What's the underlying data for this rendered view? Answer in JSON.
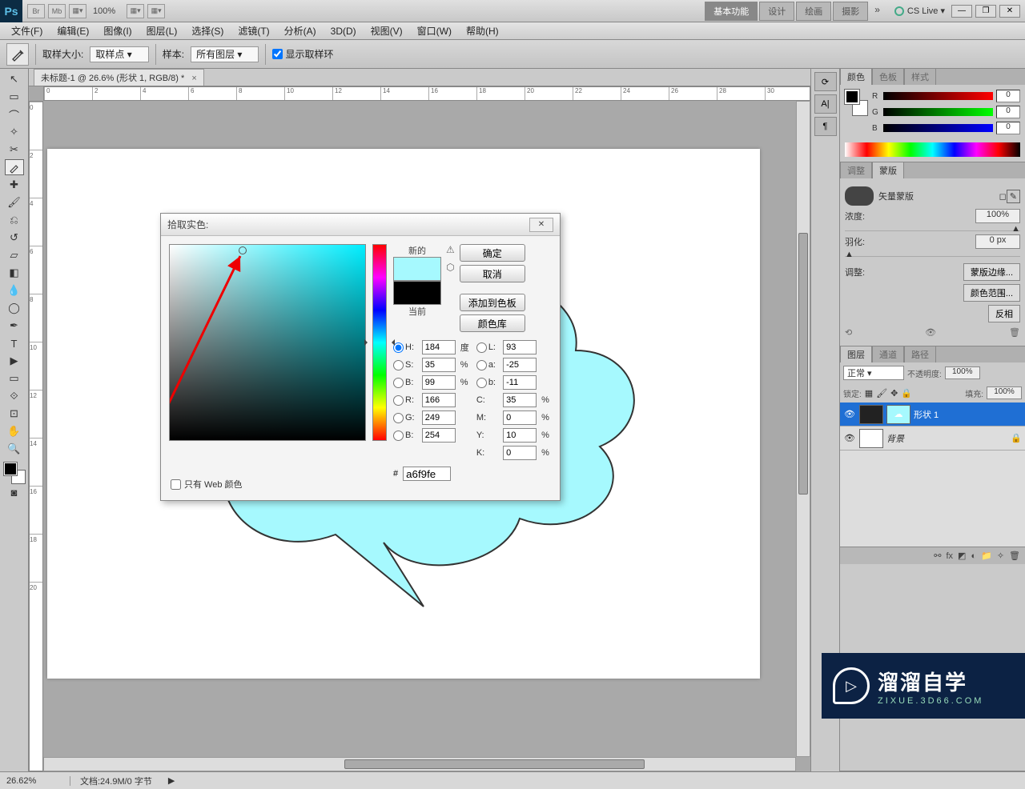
{
  "titlebar": {
    "zoom": "100%",
    "workspaces": [
      "基本功能",
      "设计",
      "绘画",
      "摄影"
    ],
    "cslive": "CS Live"
  },
  "menu": [
    "文件(F)",
    "编辑(E)",
    "图像(I)",
    "图层(L)",
    "选择(S)",
    "滤镜(T)",
    "分析(A)",
    "3D(D)",
    "视图(V)",
    "窗口(W)",
    "帮助(H)"
  ],
  "options": {
    "sample_size_label": "取样大小:",
    "sample_size_value": "取样点",
    "sample_label": "样本:",
    "sample_value": "所有图层",
    "show_ring": "显示取样环"
  },
  "doc_tab": "未标题-1 @ 26.6% (形状 1, RGB/8) *",
  "ruler_marks_h": [
    "0",
    "2",
    "4",
    "6",
    "8",
    "10",
    "12",
    "14",
    "16",
    "18",
    "20",
    "22",
    "24",
    "26",
    "28",
    "30"
  ],
  "ruler_marks_v": [
    "0",
    "2",
    "4",
    "6",
    "8",
    "10",
    "12",
    "14",
    "16",
    "18",
    "20"
  ],
  "color_panel": {
    "tabs": [
      "颜色",
      "色板",
      "样式"
    ],
    "r": "0",
    "g": "0",
    "b": "0"
  },
  "adjust_panel": {
    "tabs": [
      "调整",
      "蒙版"
    ],
    "mask_type": "矢量蒙版",
    "density_label": "浓度:",
    "density_value": "100%",
    "feather_label": "羽化:",
    "feather_value": "0 px",
    "adjust_label": "调整:",
    "btn_mask_edge": "蒙版边缘...",
    "btn_color_range": "颜色范围...",
    "btn_invert": "反相"
  },
  "layers_panel": {
    "tabs": [
      "图层",
      "通道",
      "路径"
    ],
    "blend_mode": "正常",
    "opacity_label": "不透明度:",
    "opacity_value": "100%",
    "lock_label": "锁定:",
    "fill_label": "填充:",
    "fill_value": "100%",
    "layers": [
      {
        "name": "形状 1",
        "selected": true,
        "has_mask": true
      },
      {
        "name": "背景",
        "selected": false,
        "locked": true
      }
    ]
  },
  "dialog": {
    "title": "拾取实色:",
    "new_label": "新的",
    "cur_label": "当前",
    "btn_ok": "确定",
    "btn_cancel": "取消",
    "btn_add": "添加到色板",
    "btn_lib": "颜色库",
    "H": "184",
    "H_unit": "度",
    "S": "35",
    "S_unit": "%",
    "Bv": "99",
    "B_unit": "%",
    "L": "93",
    "a": "-25",
    "b_lab": "-11",
    "R": "166",
    "G": "249",
    "B": "254",
    "C": "35",
    "C_unit": "%",
    "M": "0",
    "M_unit": "%",
    "Y": "10",
    "Y_unit": "%",
    "K": "0",
    "K_unit": "%",
    "hex": "a6f9fe",
    "web_only": "只有 Web 颜色"
  },
  "statusbar": {
    "zoom": "26.62%",
    "docinfo": "文档:24.9M/0 字节"
  },
  "watermark": {
    "main": "溜溜自学",
    "sub": "ZIXUE.3D66.COM"
  }
}
